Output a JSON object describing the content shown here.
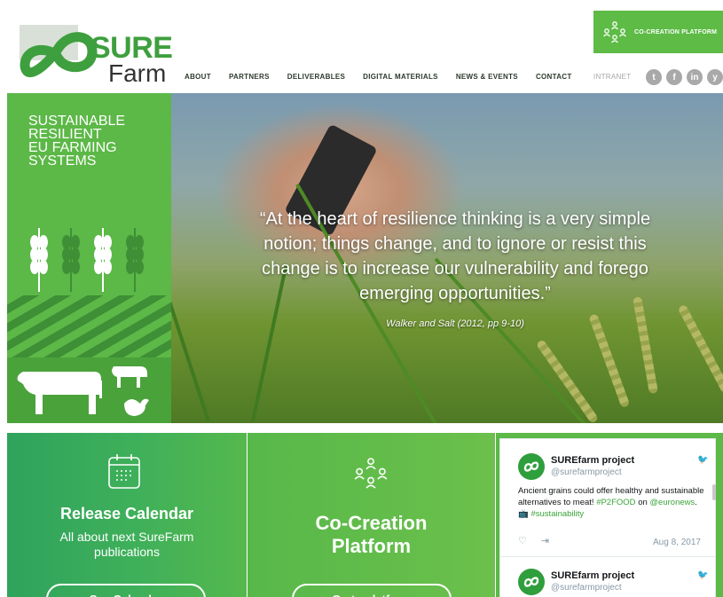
{
  "logo": {
    "word_sure": "SURE",
    "word_farm": "Farm"
  },
  "nav": {
    "items": [
      "ABOUT",
      "PARTNERS",
      "DELIVERABLES",
      "DIGITAL MATERIALS",
      "NEWS & EVENTS",
      "CONTACT"
    ],
    "intranet": "INTRANET"
  },
  "header_cta": {
    "label": "CO-CREATION PLATFORM"
  },
  "socials": [
    {
      "icon": "twitter-icon",
      "glyph": "t"
    },
    {
      "icon": "facebook-icon",
      "glyph": "f"
    },
    {
      "icon": "linkedin-icon",
      "glyph": "in"
    },
    {
      "icon": "other-social-icon",
      "glyph": "y"
    }
  ],
  "hero": {
    "tagline": [
      "SUSTAINABLE",
      "RESILIENT",
      "EU FARMING",
      "SYSTEMS"
    ],
    "quote": "“At the heart of resilience thinking is a very simple notion; things change, and to ignore or resist this change is to increase our vulnerability and forego emerging opportunities.”",
    "citation": "Walker and Salt (2012, pp 9-10)"
  },
  "panels": {
    "calendar": {
      "title": "Release Calendar",
      "subtitle": "All about next SureFarm publications",
      "button": "See Calendar"
    },
    "cocreation": {
      "title_line1": "Co-Creation",
      "title_line2": "Platform",
      "button": "Go to platform"
    }
  },
  "twitter": {
    "tweets": [
      {
        "name": "SUREfarm project",
        "handle": "@surefarmproject",
        "text_plain_1": "Ancient grains could offer healthy and sustainable alternatives to meat! ",
        "hashtag_1": "#P2FOOD",
        "text_plain_2": "on ",
        "mention": "@euronews",
        "text_plain_3": ". ",
        "emoji": "📺",
        "hashtag_2": "#sustainability",
        "date": "Aug 8, 2017"
      },
      {
        "name": "SUREfarm project",
        "handle": "@surefarmproject"
      }
    ]
  },
  "colors": {
    "brand_green": "#5cb847",
    "dark_green": "#3e9f3e",
    "social_grey": "#a9a9a9"
  }
}
